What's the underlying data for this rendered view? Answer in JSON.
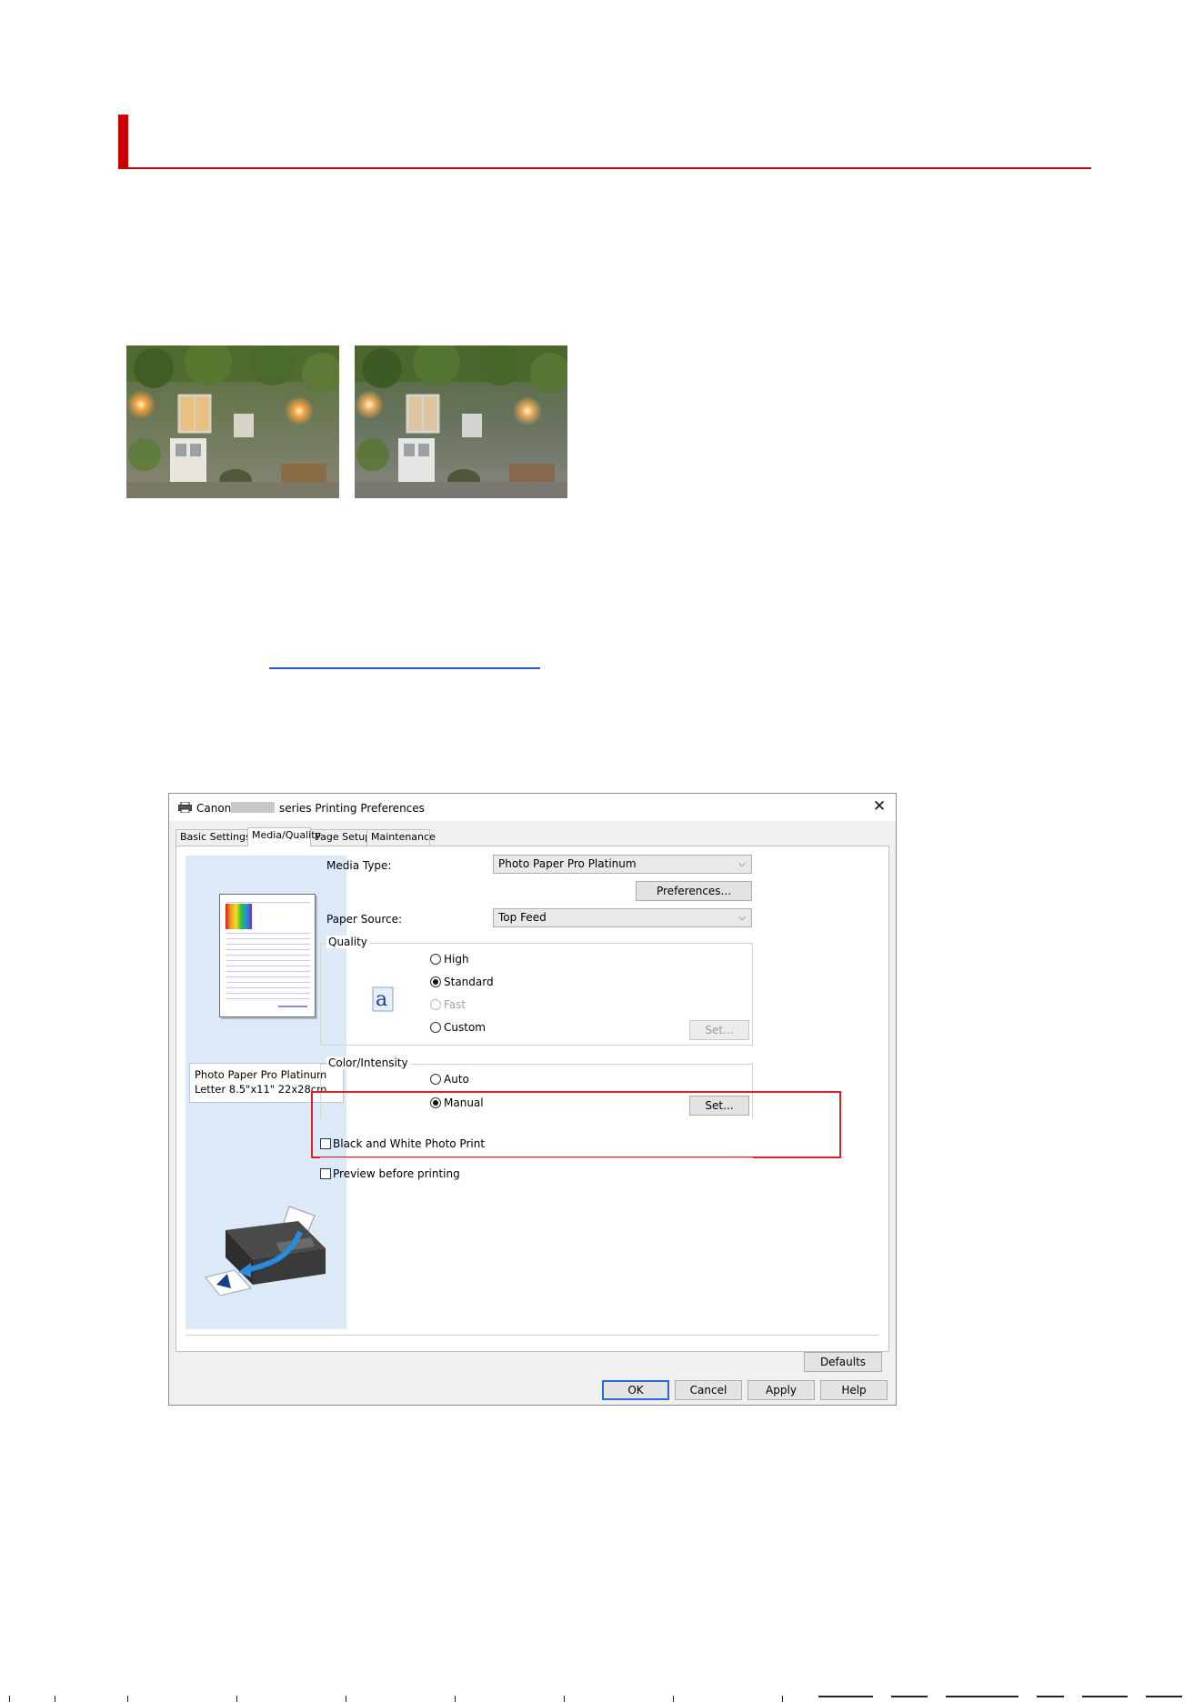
{
  "dialog": {
    "title": {
      "prefix": "Canon",
      "suffix": "series Printing Preferences"
    },
    "tabs": [
      {
        "label": "Basic Settings",
        "active": false
      },
      {
        "label": "Media/Quality",
        "active": true
      },
      {
        "label": "Page Setup",
        "active": false
      },
      {
        "label": "Maintenance",
        "active": false
      }
    ],
    "preview": {
      "paper_name": "Photo Paper Pro Platinum",
      "paper_size": "Letter 8.5\"x11\" 22x28cm"
    },
    "media_type": {
      "label": "Media Type:",
      "value": "Photo Paper Pro Platinum"
    },
    "preferences_button": "Preferences...",
    "paper_source": {
      "label": "Paper Source:",
      "value": "Top Feed"
    },
    "quality": {
      "title": "Quality",
      "options": [
        {
          "label": "High",
          "selected": false,
          "enabled": true
        },
        {
          "label": "Standard",
          "selected": true,
          "enabled": true
        },
        {
          "label": "Fast",
          "selected": false,
          "enabled": false
        },
        {
          "label": "Custom",
          "selected": false,
          "enabled": true
        }
      ],
      "set_button": "Set..."
    },
    "color_intensity": {
      "title": "Color/Intensity",
      "options": [
        {
          "label": "Auto",
          "selected": false
        },
        {
          "label": "Manual",
          "selected": true
        }
      ],
      "set_button": "Set..."
    },
    "bw_photo_print": {
      "label": "Black and White Photo Print",
      "checked": false
    },
    "preview_before_printing": {
      "label": "Preview before printing",
      "checked": false
    },
    "defaults_button": "Defaults",
    "footer_buttons": {
      "ok": "OK",
      "cancel": "Cancel",
      "apply": "Apply",
      "help": "Help"
    }
  },
  "colors": {
    "accent_red": "#cc0000",
    "highlight_red": "#e02020",
    "link_blue": "#2a5bd7",
    "preview_bg": "#dceaf8"
  },
  "icons": [
    "printer-icon",
    "close-icon",
    "chevron-down-icon",
    "quality-a-icon",
    "printer-illustration"
  ]
}
